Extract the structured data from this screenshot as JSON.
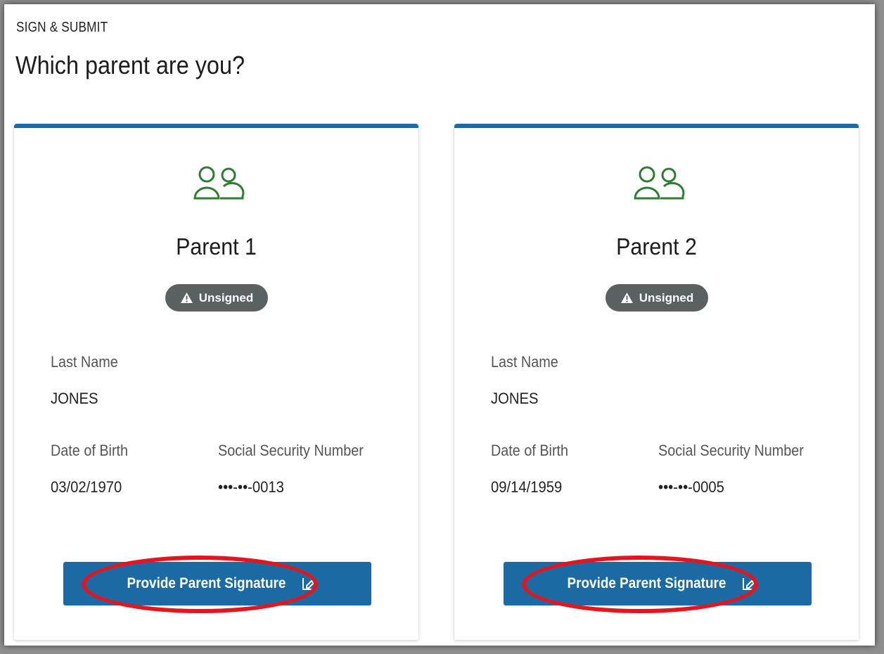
{
  "header": {
    "eyebrow": "SIGN & SUBMIT",
    "title": "Which parent are you?"
  },
  "colors": {
    "accent": "#1b6aa3",
    "icon_green": "#2e7d32",
    "badge_gray": "#5b6061",
    "highlight_red": "#e8141c"
  },
  "icons": {
    "people": "people-outline-icon",
    "warning": "warning-triangle-icon",
    "signature": "signature-icon"
  },
  "parents": [
    {
      "title": "Parent 1",
      "status": "Unsigned",
      "last_name_label": "Last Name",
      "last_name": "JONES",
      "dob_label": "Date of Birth",
      "dob": "03/02/1970",
      "ssn_label": "Social Security Number",
      "ssn": "•••-••-0013",
      "button_label": "Provide Parent Signature"
    },
    {
      "title": "Parent 2",
      "status": "Unsigned",
      "last_name_label": "Last Name",
      "last_name": "JONES",
      "dob_label": "Date of Birth",
      "dob": "09/14/1959",
      "ssn_label": "Social Security Number",
      "ssn": "•••-••-0005",
      "button_label": "Provide Parent Signature"
    }
  ]
}
